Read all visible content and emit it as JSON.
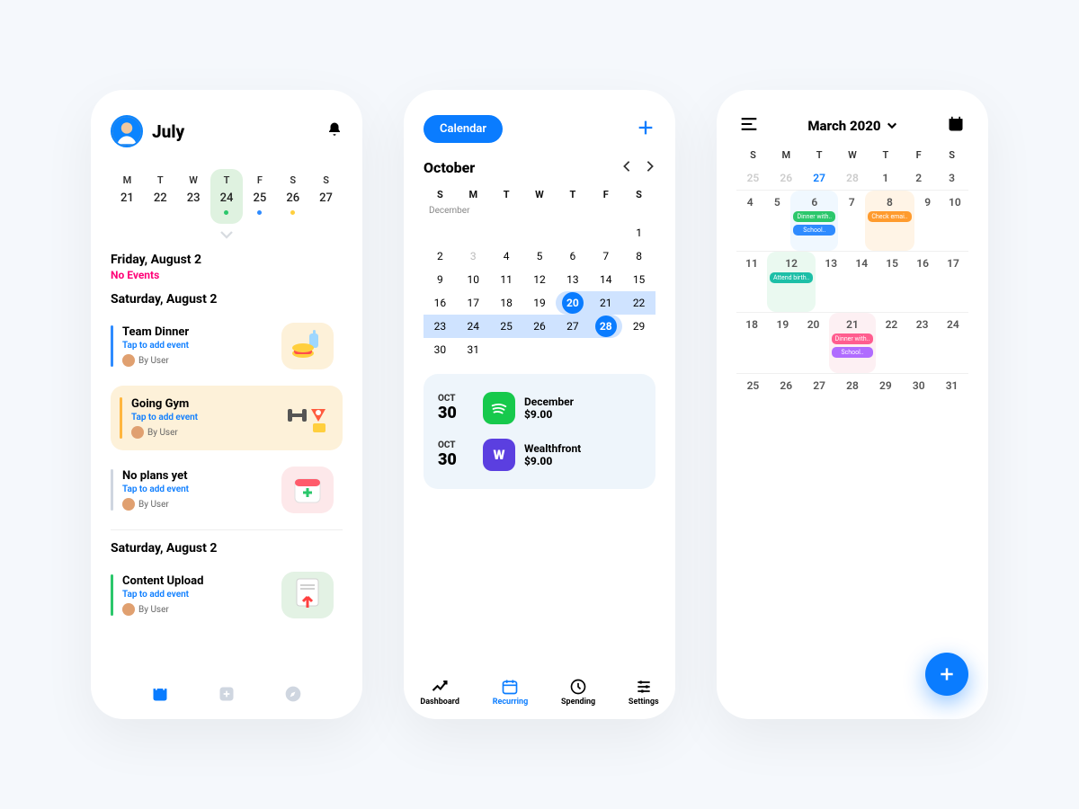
{
  "phone1": {
    "title": "July",
    "week": {
      "labels": [
        "M",
        "T",
        "W",
        "T",
        "F",
        "S",
        "S"
      ],
      "days": [
        {
          "num": "21"
        },
        {
          "num": "22"
        },
        {
          "num": "23"
        },
        {
          "num": "24",
          "selected": true,
          "dot": "#2bc76b"
        },
        {
          "num": "25",
          "dot": "#2e8bff"
        },
        {
          "num": "26",
          "dot": "#ffcf3e"
        },
        {
          "num": "27"
        }
      ]
    },
    "sections": [
      {
        "date": "Friday, August 2",
        "noEvents": "No Events"
      },
      {
        "date": "Saturday, August 2",
        "events": [
          {
            "title": "Team Dinner",
            "sub": "Tap to add event",
            "by": "By User",
            "bar": "#2e8bff",
            "iconBg": "#fdf1d9",
            "icon": "food"
          },
          {
            "title": "Going Gym",
            "sub": "Tap to add event",
            "by": "By User",
            "bar": "#ffb63e",
            "iconBg": "transparent",
            "icon": "gym",
            "highlight": true
          },
          {
            "title": "No plans yet",
            "sub": "Tap to add event",
            "by": "By User",
            "bar": "#cfd6e0",
            "iconBg": "#fde8ea",
            "icon": "calplus"
          }
        ]
      },
      {
        "date": "Saturday, August 2",
        "events": [
          {
            "title": "Content Upload",
            "sub": "Tap to add event",
            "by": "By User",
            "bar": "#2bc76b",
            "iconBg": "#e3f2e4",
            "icon": "upload"
          }
        ]
      }
    ],
    "tabs": [
      "calendar",
      "add",
      "compass"
    ]
  },
  "phone2": {
    "pill": "Calendar",
    "month": "October",
    "week": [
      "S",
      "M",
      "T",
      "W",
      "T",
      "F",
      "S"
    ],
    "miniLabel": "December",
    "calendar": [
      [
        "",
        "",
        "",
        "",
        "",
        "",
        "1"
      ],
      [
        "2",
        "3",
        "4",
        "5",
        "6",
        "7",
        "8"
      ],
      [
        "9",
        "10",
        "11",
        "12",
        "13",
        "14",
        "15"
      ],
      [
        "16",
        "17",
        "18",
        "19",
        "20",
        "21",
        "22"
      ],
      [
        "23",
        "24",
        "25",
        "26",
        "27",
        "28",
        "29"
      ],
      [
        "30",
        "31",
        "",
        "",
        "",
        "",
        ""
      ]
    ],
    "muted": [
      "3"
    ],
    "selStart": "20",
    "selEnd": "28",
    "tx": [
      {
        "mon": "OCT",
        "day": "30",
        "name": "December",
        "amount": "$9.00",
        "icon": "spotify"
      },
      {
        "mon": "OCT",
        "day": "30",
        "name": "Wealthfront",
        "amount": "$9.00",
        "icon": "wealth",
        "letter": "W"
      }
    ],
    "tabs": [
      {
        "label": "Dashboard",
        "icon": "trend"
      },
      {
        "label": "Recurring",
        "icon": "cal",
        "active": true
      },
      {
        "label": "Spending",
        "icon": "clock"
      },
      {
        "label": "Settings",
        "icon": "sliders"
      }
    ]
  },
  "phone3": {
    "title": "March 2020",
    "week": [
      "S",
      "M",
      "T",
      "W",
      "T",
      "F",
      "S"
    ],
    "firstRow": [
      "25",
      "26",
      "27",
      "28",
      "1",
      "2",
      "3"
    ],
    "firstRowToday": "27",
    "rows": [
      {
        "days": [
          "4",
          "5",
          "6",
          "7",
          "8",
          "9",
          "10"
        ],
        "cells": {
          "6": {
            "hl": "hl",
            "chips": [
              {
                "t": "Dinner with..",
                "c": "chip-green"
              },
              {
                "t": "School..",
                "c": "chip-blue"
              }
            ]
          },
          "8": {
            "hl": "hl2",
            "chips": [
              {
                "t": "Check emai..",
                "c": "chip-orange"
              }
            ]
          }
        }
      },
      {
        "days": [
          "11",
          "12",
          "13",
          "14",
          "15",
          "16",
          "17"
        ],
        "cells": {
          "12": {
            "hl": "hl3",
            "chips": [
              {
                "t": "Attend birth..",
                "c": "chip-teal"
              }
            ]
          }
        }
      },
      {
        "days": [
          "18",
          "19",
          "20",
          "21",
          "22",
          "23",
          "24"
        ],
        "cells": {
          "21": {
            "hl": "hl4",
            "chips": [
              {
                "t": "Dinner with..",
                "c": "chip-pink"
              },
              {
                "t": "School..",
                "c": "chip-purple"
              }
            ]
          }
        }
      },
      {
        "days": [
          "25",
          "26",
          "27",
          "28",
          "29",
          "30",
          "31"
        ],
        "cells": {}
      }
    ]
  }
}
